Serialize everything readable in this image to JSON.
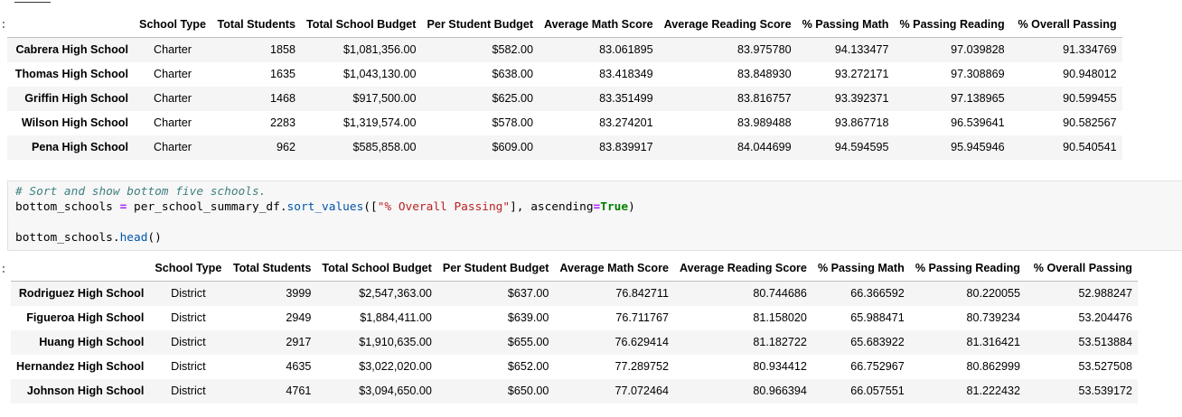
{
  "table_top": {
    "headers": [
      "School Type",
      "Total Students",
      "Total School Budget",
      "Per Student Budget",
      "Average Math Score",
      "Average Reading Score",
      "% Passing Math",
      "% Passing Reading",
      "% Overall Passing"
    ],
    "rows": [
      {
        "name": "Cabrera High School",
        "cells": [
          "Charter",
          "1858",
          "$1,081,356.00",
          "$582.00",
          "83.061895",
          "83.975780",
          "94.133477",
          "97.039828",
          "91.334769"
        ]
      },
      {
        "name": "Thomas High School",
        "cells": [
          "Charter",
          "1635",
          "$1,043,130.00",
          "$638.00",
          "83.418349",
          "83.848930",
          "93.272171",
          "97.308869",
          "90.948012"
        ]
      },
      {
        "name": "Griffin High School",
        "cells": [
          "Charter",
          "1468",
          "$917,500.00",
          "$625.00",
          "83.351499",
          "83.816757",
          "93.392371",
          "97.138965",
          "90.599455"
        ]
      },
      {
        "name": "Wilson High School",
        "cells": [
          "Charter",
          "2283",
          "$1,319,574.00",
          "$578.00",
          "83.274201",
          "83.989488",
          "93.867718",
          "96.539641",
          "90.582567"
        ]
      },
      {
        "name": "Pena High School",
        "cells": [
          "Charter",
          "962",
          "$585,858.00",
          "$609.00",
          "83.839917",
          "84.044699",
          "94.594595",
          "95.945946",
          "90.540541"
        ]
      }
    ]
  },
  "code": {
    "comment": "# Sort and show bottom five schools.",
    "var": "bottom_schools",
    "eq": "=",
    "obj": "per_school_summary_df.",
    "method": "sort_values",
    "open": "([",
    "str": "\"% Overall Passing\"",
    "mid": "], ascending",
    "eq2": "=",
    "kw": "True",
    "close": ")",
    "line2_obj": "bottom_schools.",
    "line2_method": "head",
    "line2_close": "()"
  },
  "table_bottom": {
    "headers": [
      "School Type",
      "Total Students",
      "Total School Budget",
      "Per Student Budget",
      "Average Math Score",
      "Average Reading Score",
      "% Passing Math",
      "% Passing Reading",
      "% Overall Passing"
    ],
    "rows": [
      {
        "name": "Rodriguez High School",
        "cells": [
          "District",
          "3999",
          "$2,547,363.00",
          "$637.00",
          "76.842711",
          "80.744686",
          "66.366592",
          "80.220055",
          "52.988247"
        ]
      },
      {
        "name": "Figueroa High School",
        "cells": [
          "District",
          "2949",
          "$1,884,411.00",
          "$639.00",
          "76.711767",
          "81.158020",
          "65.988471",
          "80.739234",
          "53.204476"
        ]
      },
      {
        "name": "Huang High School",
        "cells": [
          "District",
          "2917",
          "$1,910,635.00",
          "$655.00",
          "76.629414",
          "81.182722",
          "65.683922",
          "81.316421",
          "53.513884"
        ]
      },
      {
        "name": "Hernandez High School",
        "cells": [
          "District",
          "4635",
          "$3,022,020.00",
          "$652.00",
          "77.289752",
          "80.934412",
          "66.752967",
          "80.862999",
          "53.527508"
        ]
      },
      {
        "name": "Johnson High School",
        "cells": [
          "District",
          "4761",
          "$3,094,650.00",
          "$650.00",
          "77.072464",
          "80.966394",
          "66.057551",
          "81.222432",
          "53.539172"
        ]
      }
    ]
  }
}
